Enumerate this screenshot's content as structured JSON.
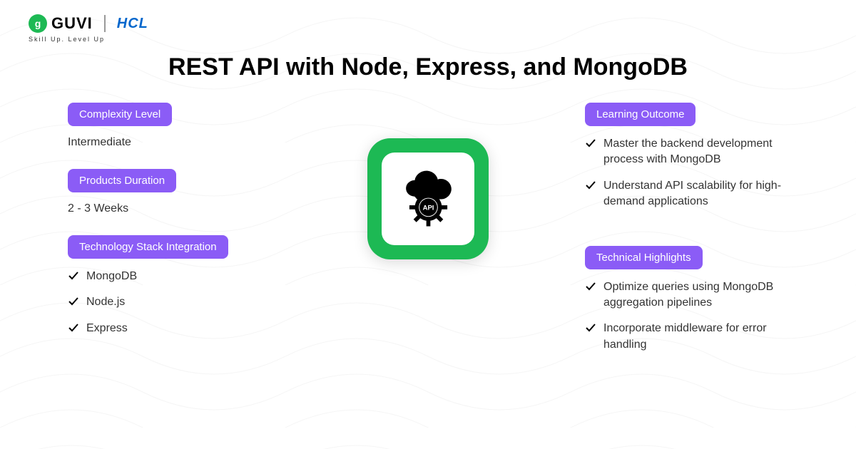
{
  "brand": {
    "guvi": "GUVI",
    "hcl": "HCL",
    "tagline": "Skill Up. Level Up"
  },
  "title": "REST API with Node, Express, and MongoDB",
  "sections": {
    "complexity": {
      "label": "Complexity Level",
      "value": "Intermediate"
    },
    "duration": {
      "label": "Products Duration",
      "value": "2 - 3 Weeks"
    },
    "tech_stack": {
      "label": "Technology Stack Integration",
      "items": [
        "MongoDB",
        "Node.js",
        "Express"
      ]
    },
    "learning_outcome": {
      "label": "Learning Outcome",
      "items": [
        "Master the backend development process with MongoDB",
        "Understand API scalability for high-demand applications"
      ]
    },
    "tech_highlights": {
      "label": "Technical Highlights",
      "items": [
        "Optimize queries using MongoDB aggregation pipelines",
        "Incorporate middleware for error handling"
      ]
    }
  },
  "colors": {
    "accent": "#8B5CF6",
    "brand_green": "#1DB954",
    "hcl_blue": "#0066CC"
  }
}
